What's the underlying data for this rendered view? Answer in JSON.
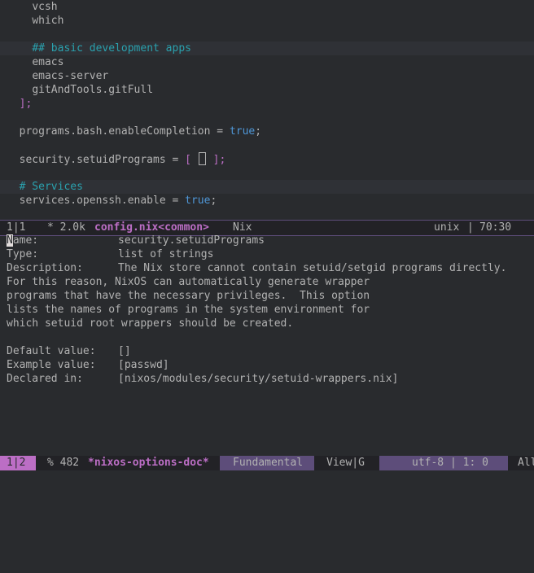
{
  "editor": {
    "lines": [
      {
        "indent": "    ",
        "text": "vcsh",
        "cls": "op"
      },
      {
        "indent": "    ",
        "text": "which",
        "cls": "op"
      },
      {
        "indent": "",
        "text": "",
        "cls": "op"
      },
      {
        "indent": "    ",
        "text": "## basic development apps",
        "cls": "cm",
        "hl": true
      },
      {
        "indent": "    ",
        "text": "emacs",
        "cls": "op"
      },
      {
        "indent": "    ",
        "text": "emacs-server",
        "cls": "op"
      },
      {
        "indent": "    ",
        "text": "gitAndTools.gitFull",
        "cls": "op"
      },
      {
        "indent": "  ",
        "text": "];",
        "cls": "br"
      },
      {
        "indent": "",
        "text": "",
        "cls": "op"
      }
    ],
    "bash_completion": {
      "key": "  programs.bash.enableCompletion = ",
      "value": "true",
      "end": ";"
    },
    "setuid": {
      "key": "  security.setuidPrograms = ",
      "open": "[",
      "close": "];"
    },
    "services_comment": "  # Services",
    "openssh": {
      "key": "  services.openssh.enable = ",
      "value": "true",
      "end": ";"
    }
  },
  "modeline_top": {
    "window": "1|1",
    "modified": "* 2.0k",
    "buffer": "config.nix<common>",
    "mode": "Nix",
    "eol": "unix",
    "sep": "|",
    "position": "70:30"
  },
  "doc": {
    "name_label": "Name:",
    "name_value": "security.setuidPrograms",
    "type_label": "Type:",
    "type_value": "list of strings",
    "desc_label": "Description:",
    "desc_first": "The Nix store cannot contain setuid/setgid programs directly.",
    "desc_lines": [
      "For this reason, NixOS can automatically generate wrapper",
      "programs that have the necessary privileges.  This option",
      "lists the names of programs in the system environment for",
      "which setuid root wrappers should be created."
    ],
    "default_label": "Default value:",
    "default_value": "[]",
    "example_label": "Example value:",
    "example_value": "[passwd]",
    "declared_label": "Declared in:",
    "declared_value": "[nixos/modules/security/setuid-wrappers.nix]"
  },
  "modeline_bottom": {
    "window": "1|2",
    "modified": "% 482",
    "buffer": "*nixos-options-doc*",
    "mode": "Fundamental",
    "state": "View|G",
    "encoding": "utf-8 | 1: 0",
    "scroll": "All"
  },
  "colors": {
    "background": "#292b2e",
    "keyword": "#4f97d7",
    "comment": "#2aa1ae",
    "accent": "#bc6ec5",
    "modeline_highlight": "#5d4d7a"
  }
}
